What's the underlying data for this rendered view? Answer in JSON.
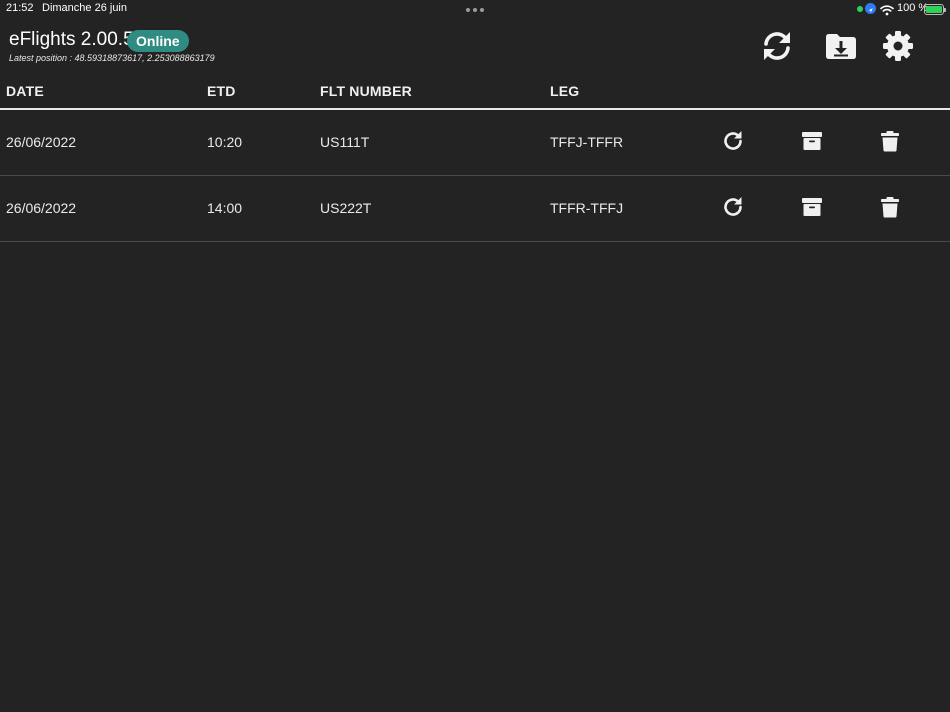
{
  "status_bar": {
    "time": "21:52",
    "date": "Dimanche 26 juin",
    "battery_text": "100 %"
  },
  "header": {
    "app_title": "eFlights 2.00.5",
    "connection_status": "Online",
    "latest_position": "Latest position : 48.59318873617, 2.253088863179",
    "actions": [
      "refresh-icon",
      "folder-download-icon",
      "gear-icon"
    ]
  },
  "table": {
    "columns": [
      "DATE",
      "ETD",
      "FLT NUMBER",
      "LEG"
    ],
    "rows": [
      {
        "date": "26/06/2022",
        "etd": "10:20",
        "flt_number": "US111T",
        "leg": "TFFJ-TFFR"
      },
      {
        "date": "26/06/2022",
        "etd": "14:00",
        "flt_number": "US222T",
        "leg": "TFFR-TFFJ"
      }
    ],
    "row_actions": [
      "reload-icon",
      "archive-icon",
      "trash-icon"
    ]
  },
  "colors": {
    "background": "#232323",
    "online_badge": "#2f8c82",
    "text": "#eaeaea"
  }
}
